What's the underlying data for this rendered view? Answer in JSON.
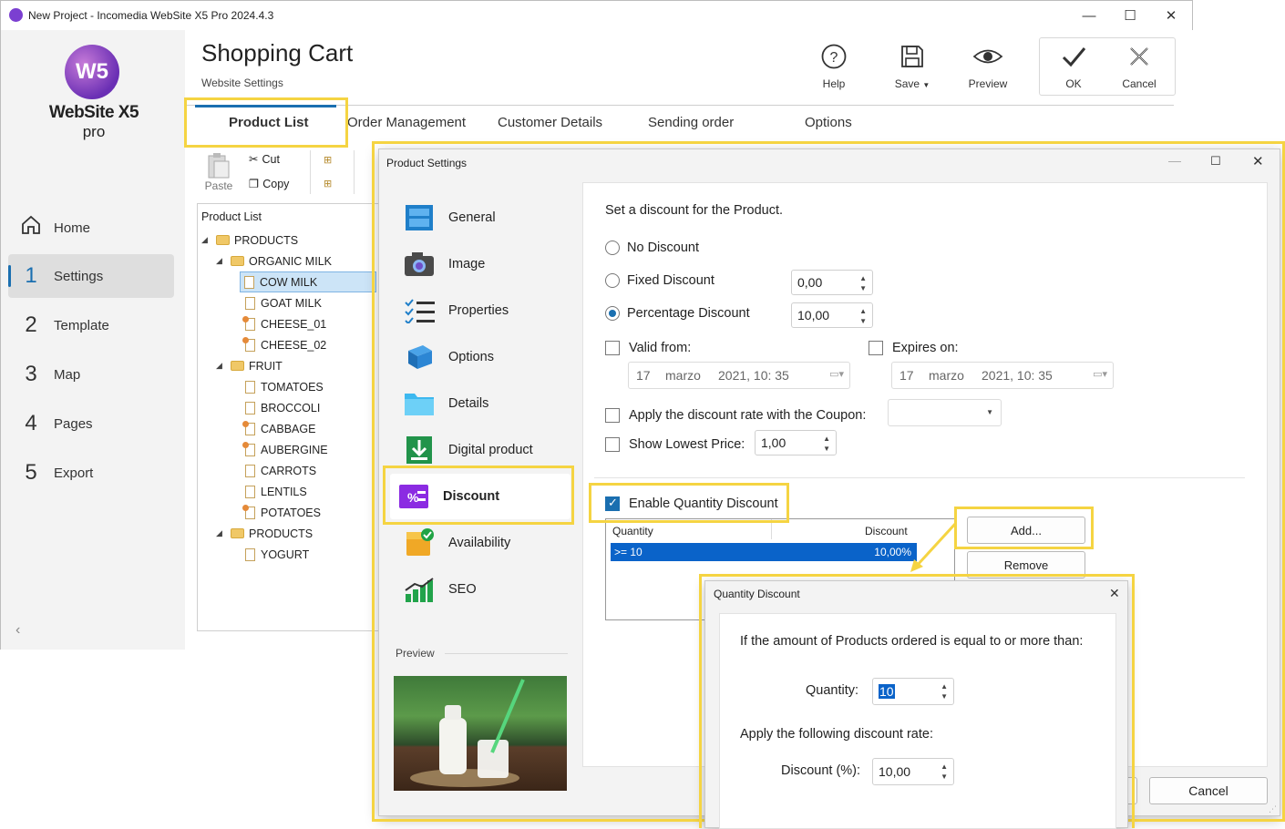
{
  "window": {
    "title": "New Project - Incomedia WebSite X5 Pro 2024.4.3",
    "controls": {
      "minimize": "—",
      "maximize": "☐",
      "close": "✕"
    }
  },
  "logo": {
    "brand": "WebSite X5",
    "edition": "pro",
    "mark": "W5"
  },
  "sidebar": {
    "items": [
      {
        "num": "",
        "label": "Home",
        "icon": "home-icon"
      },
      {
        "num": "1",
        "label": "Settings"
      },
      {
        "num": "2",
        "label": "Template"
      },
      {
        "num": "3",
        "label": "Map"
      },
      {
        "num": "4",
        "label": "Pages"
      },
      {
        "num": "5",
        "label": "Export"
      }
    ],
    "active": "Settings",
    "collapse": "‹"
  },
  "header": {
    "title": "Shopping Cart",
    "subtitle": "Website Settings",
    "toolbar": {
      "help": "Help",
      "save": "Save",
      "preview": "Preview",
      "ok": "OK",
      "cancel": "Cancel"
    }
  },
  "tabs": [
    {
      "label": "Product List",
      "active": true
    },
    {
      "label": "Order Management"
    },
    {
      "label": "Customer Details"
    },
    {
      "label": "Sending order"
    },
    {
      "label": "Options"
    }
  ],
  "ribbon": {
    "paste": "Paste",
    "cut": "Cut",
    "copy": "Copy"
  },
  "tree": {
    "header": "Product List",
    "rows": [
      {
        "label": "PRODUCTS",
        "level": 0,
        "type": "folder"
      },
      {
        "label": "ORGANIC MILK",
        "level": 1,
        "type": "folder"
      },
      {
        "label": "COW MILK",
        "level": 2,
        "type": "doc",
        "selected": true
      },
      {
        "label": "GOAT MILK",
        "level": 2,
        "type": "doc"
      },
      {
        "label": "CHEESE_01",
        "level": 2,
        "type": "doc-off"
      },
      {
        "label": "CHEESE_02",
        "level": 2,
        "type": "doc-off"
      },
      {
        "label": "FRUIT",
        "level": 1,
        "type": "folder"
      },
      {
        "label": "TOMATOES",
        "level": 2,
        "type": "doc"
      },
      {
        "label": "BROCCOLI",
        "level": 2,
        "type": "doc"
      },
      {
        "label": "CABBAGE",
        "level": 2,
        "type": "doc-off"
      },
      {
        "label": "AUBERGINE",
        "level": 2,
        "type": "doc-off"
      },
      {
        "label": "CARROTS",
        "level": 2,
        "type": "doc"
      },
      {
        "label": "LENTILS",
        "level": 2,
        "type": "doc"
      },
      {
        "label": "POTATOES",
        "level": 2,
        "type": "doc-off"
      },
      {
        "label": "PRODUCTS",
        "level": 1,
        "type": "folder"
      },
      {
        "label": "YOGURT",
        "level": 2,
        "type": "doc"
      }
    ]
  },
  "product_dialog": {
    "title": "Product Settings",
    "menu": [
      {
        "label": "General",
        "icon": "general-icon"
      },
      {
        "label": "Image",
        "icon": "camera-icon"
      },
      {
        "label": "Properties",
        "icon": "properties-icon"
      },
      {
        "label": "Options",
        "icon": "options-icon"
      },
      {
        "label": "Details",
        "icon": "folder-icon"
      },
      {
        "label": "Digital product",
        "icon": "download-icon"
      },
      {
        "label": "Discount",
        "icon": "discount-icon",
        "active": true
      },
      {
        "label": "Availability",
        "icon": "availability-icon"
      },
      {
        "label": "SEO",
        "icon": "seo-icon"
      }
    ],
    "preview_label": "Preview",
    "discount": {
      "intro": "Set a discount for the Product.",
      "no_discount": "No Discount",
      "fixed_discount": "Fixed Discount",
      "fixed_value": "0,00",
      "percentage_discount": "Percentage Discount",
      "percentage_value": "10,00",
      "selected": "Percentage Discount",
      "valid_from": "Valid from:",
      "expires_on": "Expires on:",
      "date_from": {
        "day": "17",
        "month": "marzo",
        "rest": "2021, 10: 35"
      },
      "date_to": {
        "day": "17",
        "month": "marzo",
        "rest": "2021, 10: 35"
      },
      "coupon_label": "Apply the discount rate with the Coupon:",
      "coupon_value": "",
      "lowest_price_label": "Show Lowest Price:",
      "lowest_price_value": "1,00",
      "enable_qty_label": "Enable Quantity Discount",
      "enable_qty_checked": true,
      "table_headers": [
        "Quantity",
        "Discount"
      ],
      "table_rows": [
        {
          "quantity": ">= 10",
          "discount": "10,00%"
        }
      ],
      "add_button": "Add...",
      "remove_button": "Remove"
    },
    "cancel_button": "Cancel"
  },
  "qty_dialog": {
    "title": "Quantity Discount",
    "prompt": "If the amount of Products ordered is equal to or more than:",
    "quantity_label": "Quantity:",
    "quantity_value": "10",
    "rate_prompt": "Apply the following discount rate:",
    "discount_label": "Discount (%):",
    "discount_value": "10,00"
  },
  "colors": {
    "accent": "#1a6fb0",
    "highlight": "#f5d442",
    "selection": "#0a63c9",
    "discount_icon": "#8b2be2"
  }
}
